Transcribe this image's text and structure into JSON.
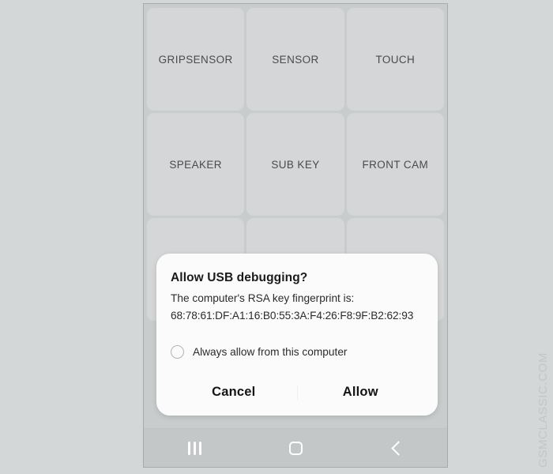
{
  "app_screen": {
    "grid_rows": [
      [
        {
          "label": "GRIPSENSOR"
        },
        {
          "label": "SENSOR"
        },
        {
          "label": "TOUCH"
        }
      ],
      [
        {
          "label": "SPEAKER"
        },
        {
          "label": "SUB KEY"
        },
        {
          "label": "FRONT CAM"
        }
      ],
      [
        {
          "label": ""
        },
        {
          "label": ""
        },
        {
          "label": ""
        }
      ]
    ]
  },
  "dialog": {
    "title": "Allow USB debugging?",
    "message": "The computer's RSA key fingerprint is:",
    "fingerprint": "68:78:61:DF:A1:16:B0:55:3A:F4:26:F8:9F:B2:62:93",
    "checkbox_label": "Always allow from this computer",
    "checkbox_checked": false,
    "cancel_label": "Cancel",
    "allow_label": "Allow"
  },
  "navigation": {
    "recents_icon": "recents-icon",
    "home_icon": "home-icon",
    "back_icon": "back-icon"
  },
  "watermark": {
    "text": "GSMCLASSIC.COM"
  },
  "colors": {
    "page_background": "#d3d7d8",
    "phone_background": "#c9cccd",
    "grid_cell": "#d4d6d7",
    "nav_bar": "#c4c7c8",
    "dialog_background": "#fbfbfb",
    "dialog_text": "#2b2b2b",
    "watermark": "#c2c6c7"
  }
}
